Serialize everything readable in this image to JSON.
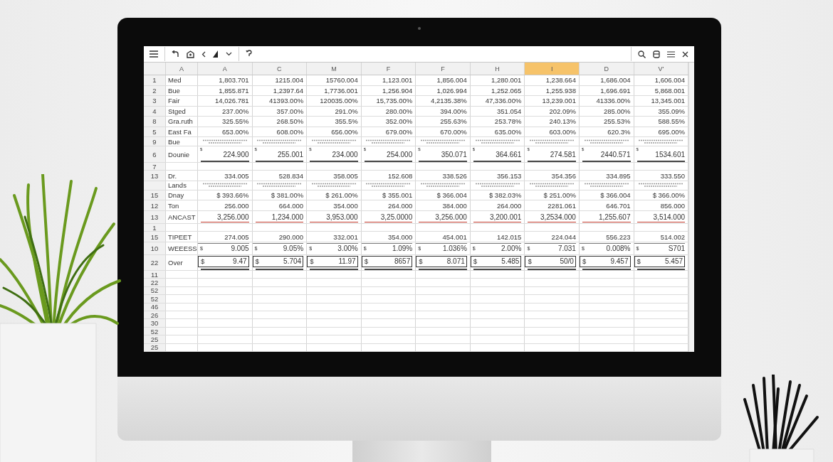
{
  "columns": [
    {
      "label": "A",
      "selected": false
    },
    {
      "label": "A",
      "selected": false
    },
    {
      "label": "C",
      "selected": false
    },
    {
      "label": "M",
      "selected": false
    },
    {
      "label": "F",
      "selected": false
    },
    {
      "label": "F",
      "selected": false
    },
    {
      "label": "H",
      "selected": false
    },
    {
      "label": "I",
      "selected": true
    },
    {
      "label": "D",
      "selected": false
    },
    {
      "label": "V'",
      "selected": false
    }
  ],
  "rows": [
    {
      "kind": "plain",
      "num": "1",
      "label": "Med",
      "cells": [
        "1,803.701",
        "1215.004",
        "15760.004",
        "1,123.001",
        "1,856.004",
        "1,280.001",
        "1,238.664",
        "1,686.004",
        "1,606.004"
      ]
    },
    {
      "kind": "plain",
      "num": "2",
      "label": "Bue",
      "cells": [
        "1,855.871",
        "1,2397.64",
        "1,7736.001",
        "1,256.904",
        "1,026.994",
        "1,252.065",
        "1,255.938",
        "1,696.691",
        "5,868.001"
      ]
    },
    {
      "kind": "plain",
      "num": "3",
      "label": "Fair",
      "cells": [
        "14,026.781",
        "41393.00%",
        "120035.00%",
        "15,735.00%",
        "4,2135.38%",
        "47,336.00%",
        "13,239.001",
        "41336.00%",
        "13,345.001"
      ]
    },
    {
      "kind": "plain",
      "num": "4",
      "label": "Stged",
      "cells": [
        "237.00%",
        "357.00%",
        "291.0%",
        "280.00%",
        "394.00%",
        "351.054",
        "202.09%",
        "285.00%",
        "355.09%"
      ]
    },
    {
      "kind": "plain",
      "num": "8",
      "label": "Gra.ruth",
      "cells": [
        "325.55%",
        "268.50%",
        "355.5%",
        "352.00%",
        "255.63%",
        "253.78%",
        "240.13%",
        "255.53%",
        "588.55%"
      ]
    },
    {
      "kind": "plain",
      "num": "5",
      "label": "East Fa",
      "cells": [
        "653.00%",
        "608.00%",
        "656.00%",
        "679.00%",
        "670.00%",
        "635.00%",
        "603.00%",
        "620.3%",
        "695.00%"
      ]
    },
    {
      "kind": "scribble",
      "num": "9",
      "label": "Bue"
    },
    {
      "kind": "total",
      "num": "6",
      "label": "Dounie",
      "cells": [
        {
          "sign": "$",
          "value": "224.900"
        },
        {
          "sign": "$",
          "value": "255.001"
        },
        {
          "sign": "$",
          "value": "234.000"
        },
        {
          "sign": "$",
          "value": "254.000"
        },
        {
          "sign": "$",
          "value": "350.071"
        },
        {
          "sign": "$",
          "value": "364.661"
        },
        {
          "sign": "$",
          "value": "274.581"
        },
        {
          "sign": "$",
          "value": "2440.571"
        },
        {
          "sign": "$",
          "value": "1534.601"
        }
      ]
    },
    {
      "kind": "blank",
      "num": "7"
    },
    {
      "kind": "plain",
      "num": "13",
      "label": "Dr.",
      "cells": [
        "334.005",
        "528.834",
        "358.005",
        "152.608",
        "338.526",
        "356.153",
        "354.356",
        "334.895",
        "333.550"
      ]
    },
    {
      "kind": "scribble",
      "label": "Lands"
    },
    {
      "kind": "plain",
      "num": "15",
      "label": "Dnay",
      "cells": [
        "$ 393.66%",
        "$ 381.00%",
        "$ 261.00%",
        "$ 355.001",
        "$ 366.004",
        "$ 382.03%",
        "$ 251.00%",
        "$ 366.004",
        "$ 366.00%"
      ]
    },
    {
      "kind": "plain",
      "num": "12",
      "label": "Ton",
      "cells": [
        "256.000",
        "664.000",
        "354.000",
        "264.000",
        "384.000",
        "264.000",
        "2281.061",
        "646.701",
        "856.000"
      ]
    },
    {
      "kind": "red",
      "num": "13",
      "label": "ANCAST",
      "cells": [
        "3,256.000",
        "1,234.000",
        "3,953.000",
        "3,25.0000",
        "3,256.000",
        "3,200.001",
        "3,2534.000",
        "1,255.607",
        "3,514.000"
      ]
    },
    {
      "kind": "blank",
      "num": "1"
    },
    {
      "kind": "plain",
      "num": "15",
      "label": "TIPEET",
      "cells": [
        "274.005",
        "290.000",
        "332.001",
        "354.000",
        "454.001",
        "142.015",
        "224.044",
        "556.223",
        "514.002"
      ]
    },
    {
      "kind": "signed",
      "num": "10",
      "label": "WEEESS",
      "cells": [
        {
          "sign": "$",
          "value": "9.005"
        },
        {
          "sign": "$",
          "value": "9.05%"
        },
        {
          "sign": "$",
          "value": "3.00%"
        },
        {
          "sign": "$",
          "value": "1.09%"
        },
        {
          "sign": "$",
          "value": "1.036%"
        },
        {
          "sign": "$",
          "value": "2.00%"
        },
        {
          "sign": "$",
          "value": "7.031"
        },
        {
          "sign": "$",
          "value": "0.008%"
        },
        {
          "sign": "$",
          "value": "S701"
        }
      ]
    },
    {
      "kind": "boxed",
      "num": "22",
      "label": "Over",
      "cells": [
        {
          "sign": "$",
          "value": "9.47"
        },
        {
          "sign": "$",
          "value": "5.704"
        },
        {
          "sign": "$",
          "value": "11.97"
        },
        {
          "sign": "$",
          "value": "8657"
        },
        {
          "sign": "$",
          "value": "8.071"
        },
        {
          "sign": "$",
          "value": "5.485"
        },
        {
          "sign": "$",
          "value": "50/0"
        },
        {
          "sign": "$",
          "value": "9.457"
        },
        {
          "sign": "$",
          "value": "5.457"
        }
      ]
    },
    {
      "kind": "blank",
      "num": "11"
    },
    {
      "kind": "blank",
      "num": "22"
    },
    {
      "kind": "blank",
      "num": "52"
    },
    {
      "kind": "blank",
      "num": "52"
    },
    {
      "kind": "blank",
      "num": "46"
    },
    {
      "kind": "blank",
      "num": "26"
    },
    {
      "kind": "blank",
      "num": "30"
    },
    {
      "kind": "blank",
      "num": "52"
    },
    {
      "kind": "blank",
      "num": "25"
    },
    {
      "kind": "blank",
      "num": "25"
    }
  ]
}
